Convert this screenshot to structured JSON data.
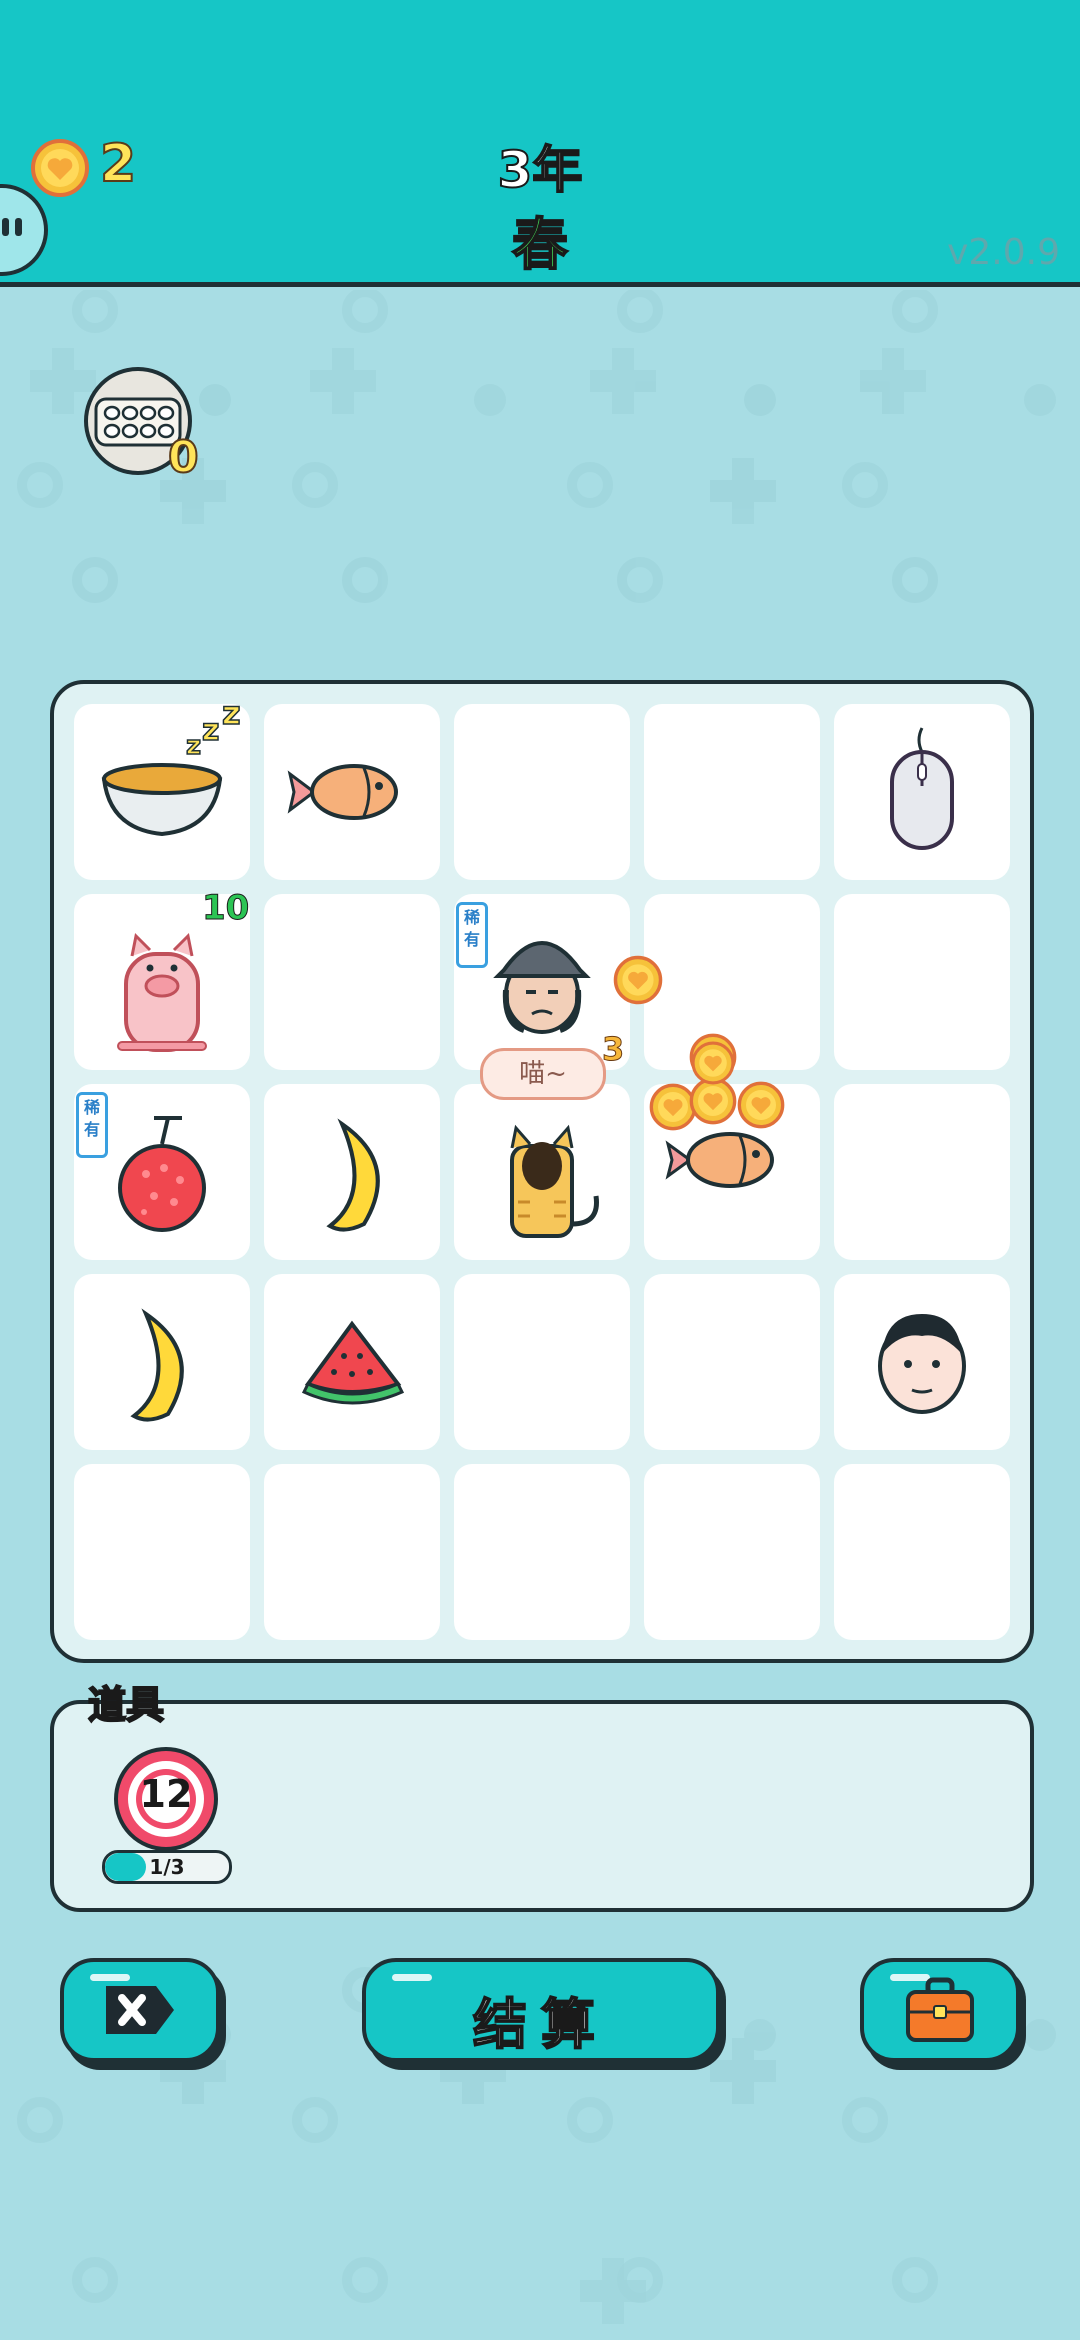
{
  "header": {
    "coins": "2",
    "year": "3年",
    "season": "春",
    "version": "v2.0.9"
  },
  "eggs_count": "0",
  "board": {
    "pig_count": "10",
    "rare_label": "稀有",
    "speech": "喵~",
    "speech_count": "3"
  },
  "items": {
    "label": "道具",
    "target_count": "12",
    "progress_text": "1/3",
    "progress_fraction": 0.333
  },
  "buttons": {
    "settle_label": "结算"
  },
  "colors": {
    "header": "#16c6c6",
    "background": "#a8dde4",
    "accent": "#16c6c6"
  }
}
